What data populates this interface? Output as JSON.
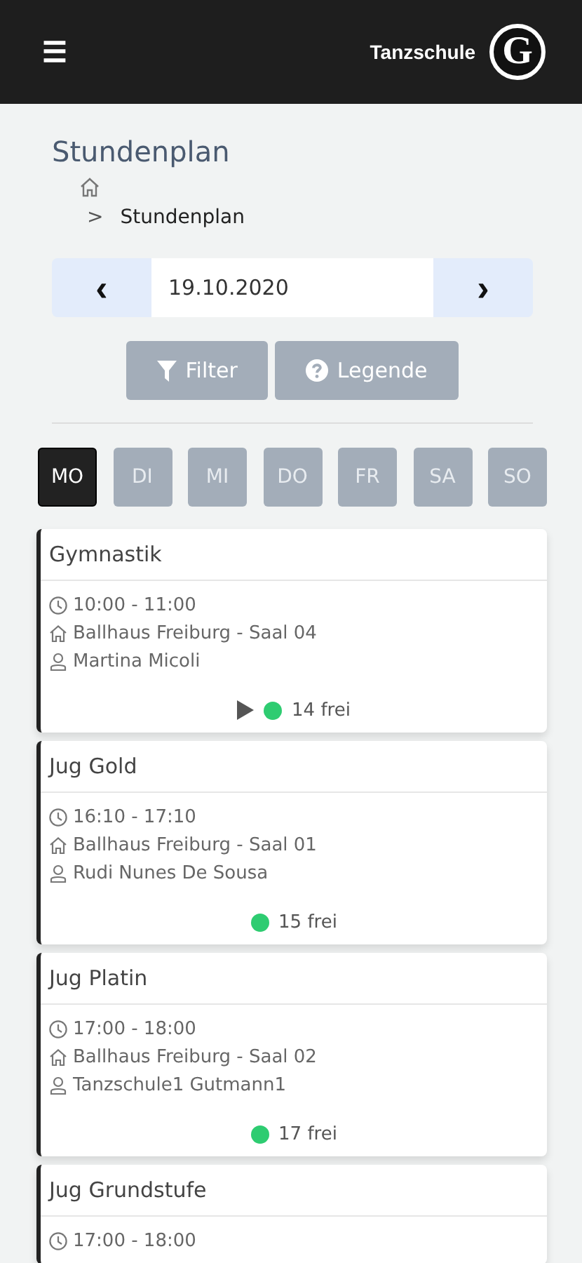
{
  "header": {
    "menu_icon": "☰",
    "brand": "Tanzschule",
    "logo_letter": "G"
  },
  "page_title": "Stundenplan",
  "breadcrumb": {
    "separator": ">",
    "current": "Stundenplan"
  },
  "date_picker": {
    "prev": "‹",
    "value": "19.10.2020",
    "next": "›"
  },
  "buttons": [
    {
      "label": "Filter",
      "kind": "filter"
    },
    {
      "label": "Legende",
      "kind": "help"
    }
  ],
  "days": [
    {
      "label": "MO",
      "selected": true
    },
    {
      "label": "DI",
      "selected": false
    },
    {
      "label": "MI",
      "selected": false
    },
    {
      "label": "DO",
      "selected": false
    },
    {
      "label": "FR",
      "selected": false
    },
    {
      "label": "SA",
      "selected": false
    },
    {
      "label": "SO",
      "selected": false
    }
  ],
  "courses": [
    {
      "title": "Gymnastik",
      "time": "10:00 - 11:00",
      "venue": "Ballhaus Freiburg - Saal 04",
      "teacher": "Martina Micoli",
      "playable": true,
      "color": "#2ecc71",
      "free": "14 frei"
    },
    {
      "title": "Jug Gold",
      "time": "16:10 - 17:10",
      "venue": "Ballhaus Freiburg - Saal 01",
      "teacher": "Rudi Nunes De Sousa",
      "playable": false,
      "color": "#2ecc71",
      "free": "15 frei"
    },
    {
      "title": "Jug Platin",
      "time": "17:00 - 18:00",
      "venue": "Ballhaus Freiburg - Saal 02",
      "teacher": "Tanzschule1 Gutmann1",
      "playable": false,
      "color": "#2ecc71",
      "free": "17 frei"
    },
    {
      "title": "Jug Grundstufe",
      "time": "17:00 - 18:00"
    }
  ]
}
